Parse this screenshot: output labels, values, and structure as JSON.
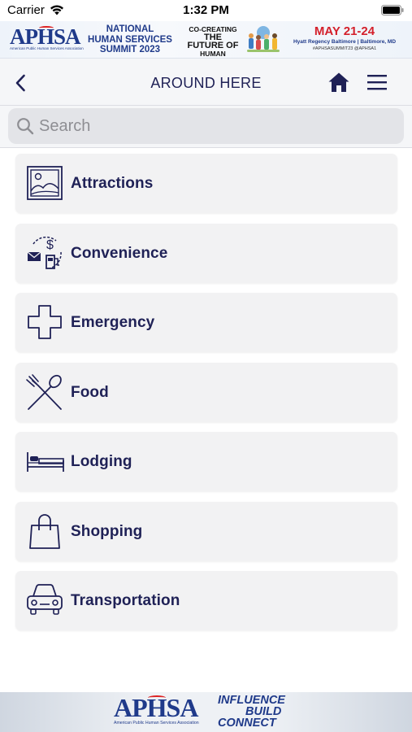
{
  "status_bar": {
    "carrier": "Carrier",
    "time": "1:32 PM"
  },
  "banner": {
    "org_logo": "APHSA",
    "org_full_name": "American Public Human Services Association",
    "summit_title_line1": "NATIONAL",
    "summit_title_line2": "HUMAN SERVICES",
    "summit_title_line3": "SUMMIT 2023",
    "theme_line1": "CO-CREATING",
    "theme_line2": "THE FUTURE OF",
    "theme_line3": "HUMAN SERVICES",
    "dates": "MAY 21-24",
    "venue": "Hyatt Regency Baltimore | Baltimore, MD",
    "hashtags": "#APHSASUMMIT23  @APHSA1"
  },
  "nav": {
    "title": "AROUND HERE"
  },
  "search": {
    "placeholder": "Search",
    "value": ""
  },
  "categories": [
    {
      "label": "Attractions",
      "icon": "landscape-picture-icon"
    },
    {
      "label": "Convenience",
      "icon": "convenience-icon"
    },
    {
      "label": "Emergency",
      "icon": "medical-cross-icon"
    },
    {
      "label": "Food",
      "icon": "fork-spoon-icon"
    },
    {
      "label": "Lodging",
      "icon": "bed-icon"
    },
    {
      "label": "Shopping",
      "icon": "shopping-bag-icon"
    },
    {
      "label": "Transportation",
      "icon": "car-icon"
    }
  ],
  "footer": {
    "org_logo": "APHSA",
    "org_full_name": "American Public Human Services Association",
    "slogan_line1": "INFLUENCE",
    "slogan_line2": "BUILD",
    "slogan_line3": "CONNECT"
  },
  "colors": {
    "primary_navy": "#1f2156",
    "brand_blue": "#1f3a8a",
    "accent_red": "#d41f2a",
    "card_bg": "#f2f2f3"
  }
}
